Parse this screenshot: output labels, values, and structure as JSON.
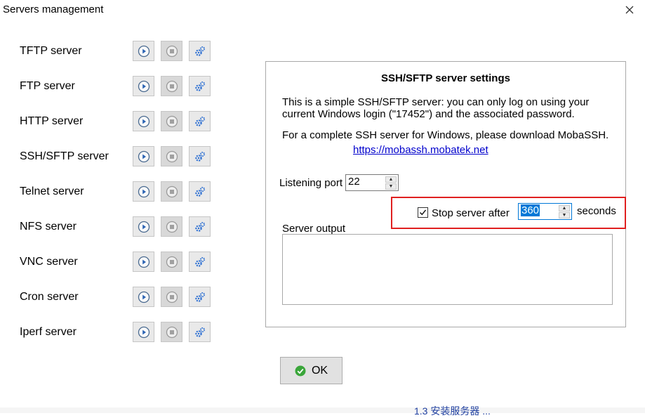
{
  "window": {
    "title": "Servers management"
  },
  "servers": [
    {
      "label": "TFTP server"
    },
    {
      "label": "FTP server"
    },
    {
      "label": "HTTP server"
    },
    {
      "label": "SSH/SFTP server"
    },
    {
      "label": "Telnet server"
    },
    {
      "label": "NFS server"
    },
    {
      "label": "VNC server"
    },
    {
      "label": "Cron server"
    },
    {
      "label": "Iperf server"
    }
  ],
  "settings": {
    "title": "SSH/SFTP server settings",
    "desc_line1": "This is a simple SSH/SFTP server: you can only log on using your",
    "desc_line2": "current Windows login (\"17452\") and the associated password.",
    "download_text": "For a complete SSH server for Windows, please download MobaSSH.",
    "link": "https://mobassh.mobatek.net",
    "listening_port_label": "Listening port",
    "listening_port_value": "22",
    "stop_after_label": "Stop server after",
    "stop_after_checked": true,
    "stop_after_value": "360",
    "seconds_label": "seconds",
    "output_label": "Server output",
    "output_text": ""
  },
  "ok_button": {
    "label": "OK"
  },
  "bottom_fragment": "1.3  安装服务器 ..."
}
